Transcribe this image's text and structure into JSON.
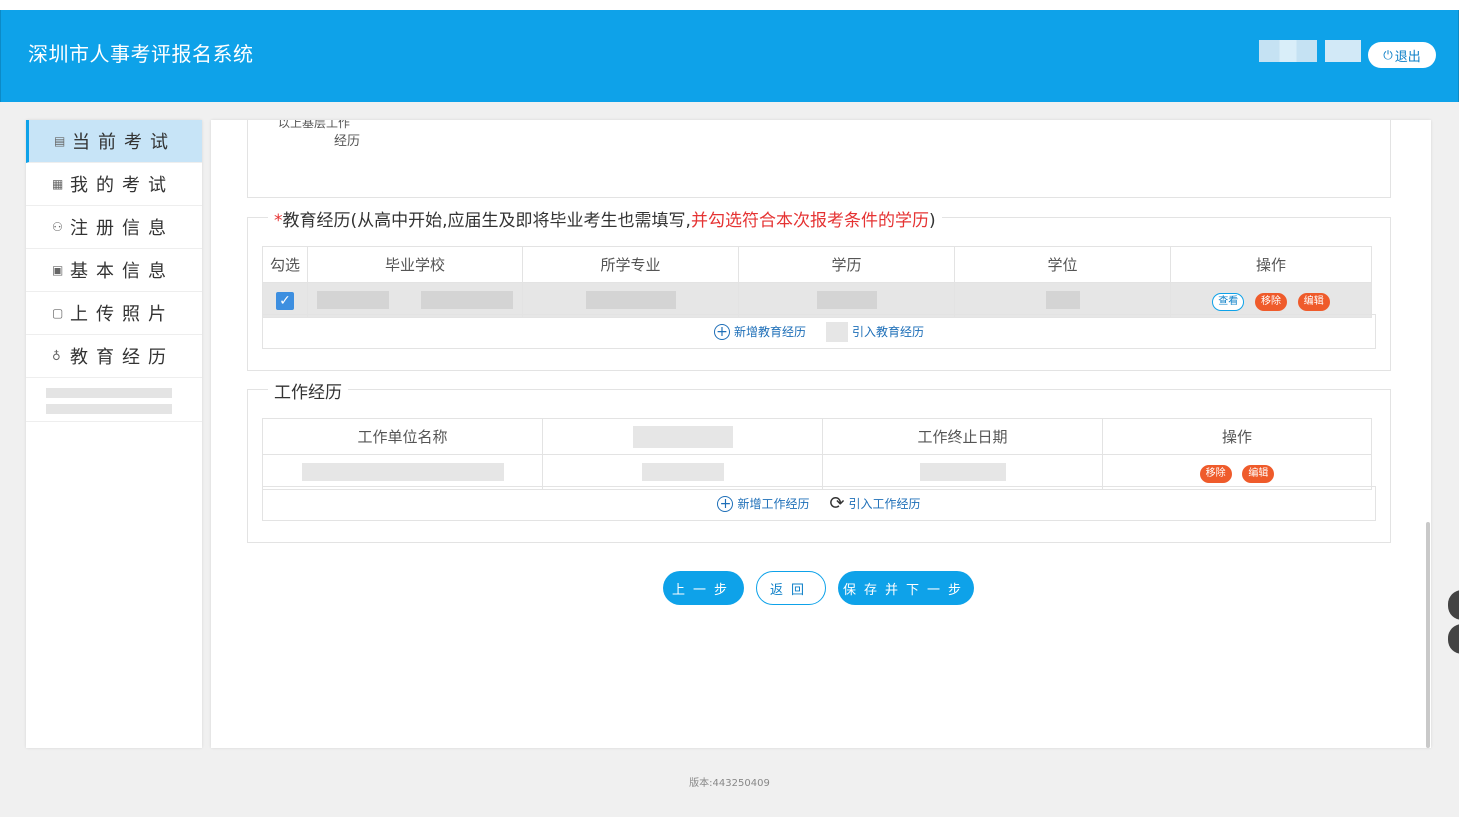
{
  "header": {
    "title": "深圳市人事考评报名系统",
    "logout_label": "退出"
  },
  "sidebar": {
    "items": [
      {
        "label": "当前考试",
        "icon": "exam-icon",
        "active": true
      },
      {
        "label": "我的考试",
        "icon": "doc-icon"
      },
      {
        "label": "注册信息",
        "icon": "user-icon"
      },
      {
        "label": "基本信息",
        "icon": "info-icon"
      },
      {
        "label": "上传照片",
        "icon": "photo-icon"
      },
      {
        "label": "教育经历",
        "icon": "cap-icon"
      }
    ]
  },
  "prev_section": {
    "line1": "以上基层工作",
    "line2": "经历"
  },
  "education": {
    "legend_prefix": "*",
    "legend_text": "教育经历(从高中开始,应届生及即将毕业考生也需填写,",
    "legend_red": "并勾选符合本次报考条件的学历",
    "legend_suffix": ")",
    "columns": [
      "勾选",
      "毕业学校",
      "所学专业",
      "学历",
      "学位",
      "操作"
    ],
    "row_actions": {
      "view": "查看",
      "remove": "移除",
      "edit": "编辑"
    },
    "add_label": "新增教育经历",
    "import_label": "引入教育经历"
  },
  "work": {
    "legend": "工作经历",
    "columns": [
      "工作单位名称",
      "",
      "工作终止日期",
      "操作"
    ],
    "row_actions": {
      "remove": "移除",
      "edit": "编辑"
    },
    "add_label": "新增工作经历",
    "import_label": "引入工作经历"
  },
  "buttons": {
    "prev": "上一步",
    "back": "返回",
    "save_next": "保存并下一步"
  },
  "footer": {
    "version": "版本:443250409"
  },
  "colors": {
    "primary": "#0ea2e9",
    "danger": "#ef5b2b",
    "required": "#e53333"
  }
}
